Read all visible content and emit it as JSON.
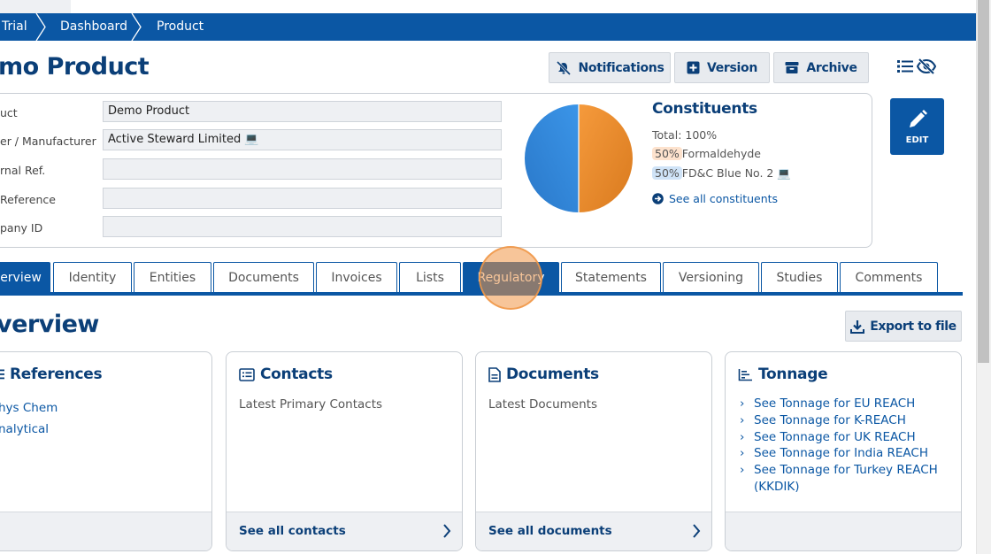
{
  "breadcrumb": [
    "Trial",
    "Dashboard",
    "Product"
  ],
  "page_title": "mo Product",
  "header_buttons": {
    "notifications": "Notifications",
    "version": "Version",
    "archive": "Archive"
  },
  "fields": [
    {
      "label": "uct",
      "value": "Demo Product"
    },
    {
      "label": "er / Manufacturer",
      "value": "Active Steward Limited 💻"
    },
    {
      "label": "rnal Ref.",
      "value": ""
    },
    {
      "label": "Reference",
      "value": ""
    },
    {
      "label": "pany ID",
      "value": ""
    }
  ],
  "constituents": {
    "title": "Constituents",
    "total": "Total: 100%",
    "items": [
      {
        "pct": "50%",
        "name": "Formaldehyde",
        "color": "#f08a2c"
      },
      {
        "pct": "50%",
        "name": "FD&C Blue No. 2 💻",
        "color": "#2f86d9"
      }
    ],
    "see_all": "See all constituents"
  },
  "edit_label": "EDIT",
  "tabs": [
    "erview",
    "Identity",
    "Entities",
    "Documents",
    "Invoices",
    "Lists",
    "Regulatory",
    "Statements",
    "Versioning",
    "Studies",
    "Comments"
  ],
  "active_tab": "erview",
  "section_title": "verview",
  "export_label": "Export to file",
  "cards": {
    "references": {
      "title": "References",
      "items": [
        "hys Chem",
        "nalytical"
      ]
    },
    "contacts": {
      "title": "Contacts",
      "text": "Latest Primary Contacts",
      "footer": "See all contacts"
    },
    "documents": {
      "title": "Documents",
      "text": "Latest Documents",
      "footer": "See all documents"
    },
    "tonnage": {
      "title": "Tonnage",
      "items": [
        "See Tonnage for EU REACH",
        "See Tonnage for K-REACH",
        "See Tonnage for UK REACH",
        "See Tonnage for India REACH",
        "See Tonnage for Turkey REACH (KKDIK)"
      ]
    }
  },
  "colors": {
    "primary": "#0b57a4",
    "heading": "#0b3f78",
    "accent_orange": "#f08a2c",
    "accent_blue": "#2f86d9"
  }
}
